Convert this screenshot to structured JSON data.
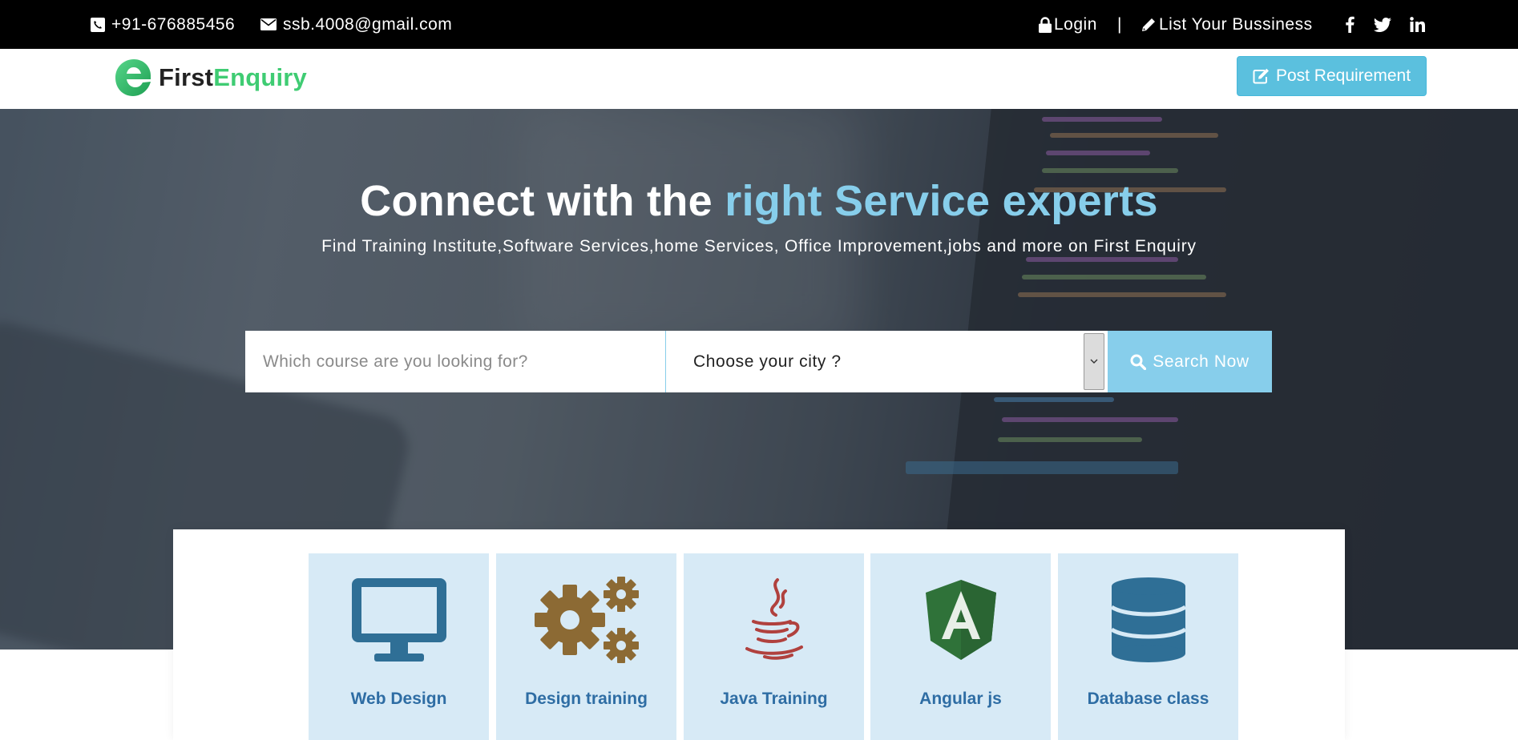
{
  "topbar": {
    "phone": "+91-676885456",
    "email": "ssb.4008@gmail.com",
    "login": "Login",
    "separator": "|",
    "list_business": "List Your Bussiness",
    "social": [
      "facebook-icon",
      "twitter-icon",
      "linkedin-icon"
    ]
  },
  "header": {
    "logo_first": "First",
    "logo_enquiry": "Enquiry",
    "post_requirement": "Post Requirement"
  },
  "hero": {
    "title_plain": "Connect with the",
    "title_accent": "right Service experts",
    "subtitle": "Find Training Institute,Software Services,home Services, Office Improvement,jobs and more on First Enquiry"
  },
  "search": {
    "placeholder": "Which course are you looking for?",
    "city_selected": "Choose your city ?",
    "button": "Search Now"
  },
  "categories": [
    {
      "label": "Web Design",
      "icon": "monitor-icon"
    },
    {
      "label": "Design training",
      "icon": "gears-icon"
    },
    {
      "label": "Java Training",
      "icon": "java-icon"
    },
    {
      "label": "Angular js",
      "icon": "angular-icon"
    },
    {
      "label": "Database class",
      "icon": "database-icon"
    }
  ],
  "colors": {
    "topbar_bg": "#000000",
    "accent": "#87ceeb",
    "post_button": "#5bc0de",
    "card_bg": "#d7eaf6",
    "card_text": "#2e6da4",
    "logo_green": "#3fcc73"
  }
}
